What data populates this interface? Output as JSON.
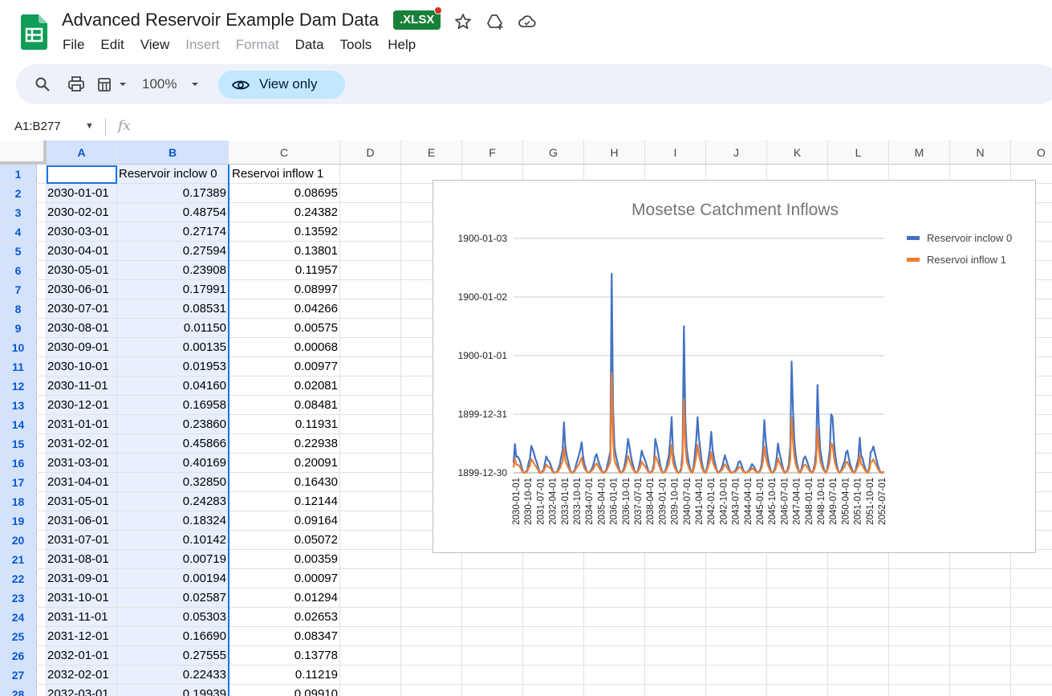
{
  "header": {
    "doc_title": "Advanced Reservoir Example Dam Data",
    "file_badge": ".XLSX",
    "menu": [
      {
        "label": "File",
        "enabled": true
      },
      {
        "label": "Edit",
        "enabled": true
      },
      {
        "label": "View",
        "enabled": true
      },
      {
        "label": "Insert",
        "enabled": false
      },
      {
        "label": "Format",
        "enabled": false
      },
      {
        "label": "Data",
        "enabled": true
      },
      {
        "label": "Tools",
        "enabled": true
      },
      {
        "label": "Help",
        "enabled": true
      }
    ]
  },
  "toolbar": {
    "zoom": "100%",
    "view_only": "View only"
  },
  "formula_bar": {
    "name_box": "A1:B277",
    "fx": "fx"
  },
  "columns": [
    "A",
    "B",
    "C",
    "D",
    "E",
    "F",
    "G",
    "H",
    "I",
    "J",
    "K",
    "L",
    "M",
    "N",
    "O"
  ],
  "rows": [
    {
      "n": "1",
      "a": "",
      "b": "Reservoir inclow 0",
      "c": "Reservoi inflow 1"
    },
    {
      "n": "2",
      "a": "2030-01-01",
      "b": "0.17389",
      "c": "0.08695"
    },
    {
      "n": "3",
      "a": "2030-02-01",
      "b": "0.48754",
      "c": "0.24382"
    },
    {
      "n": "4",
      "a": "2030-03-01",
      "b": "0.27174",
      "c": "0.13592"
    },
    {
      "n": "5",
      "a": "2030-04-01",
      "b": "0.27594",
      "c": "0.13801"
    },
    {
      "n": "6",
      "a": "2030-05-01",
      "b": "0.23908",
      "c": "0.11957"
    },
    {
      "n": "7",
      "a": "2030-06-01",
      "b": "0.17991",
      "c": "0.08997"
    },
    {
      "n": "8",
      "a": "2030-07-01",
      "b": "0.08531",
      "c": "0.04266"
    },
    {
      "n": "9",
      "a": "2030-08-01",
      "b": "0.01150",
      "c": "0.00575"
    },
    {
      "n": "10",
      "a": "2030-09-01",
      "b": "0.00135",
      "c": "0.00068"
    },
    {
      "n": "11",
      "a": "2030-10-01",
      "b": "0.01953",
      "c": "0.00977"
    },
    {
      "n": "12",
      "a": "2030-11-01",
      "b": "0.04160",
      "c": "0.02081"
    },
    {
      "n": "13",
      "a": "2030-12-01",
      "b": "0.16958",
      "c": "0.08481"
    },
    {
      "n": "14",
      "a": "2031-01-01",
      "b": "0.23860",
      "c": "0.11931"
    },
    {
      "n": "15",
      "a": "2031-02-01",
      "b": "0.45866",
      "c": "0.22938"
    },
    {
      "n": "16",
      "a": "2031-03-01",
      "b": "0.40169",
      "c": "0.20091"
    },
    {
      "n": "17",
      "a": "2031-04-01",
      "b": "0.32850",
      "c": "0.16430"
    },
    {
      "n": "18",
      "a": "2031-05-01",
      "b": "0.24283",
      "c": "0.12144"
    },
    {
      "n": "19",
      "a": "2031-06-01",
      "b": "0.18324",
      "c": "0.09164"
    },
    {
      "n": "20",
      "a": "2031-07-01",
      "b": "0.10142",
      "c": "0.05072"
    },
    {
      "n": "21",
      "a": "2031-08-01",
      "b": "0.00719",
      "c": "0.00359"
    },
    {
      "n": "22",
      "a": "2031-09-01",
      "b": "0.00194",
      "c": "0.00097"
    },
    {
      "n": "23",
      "a": "2031-10-01",
      "b": "0.02587",
      "c": "0.01294"
    },
    {
      "n": "24",
      "a": "2031-11-01",
      "b": "0.05303",
      "c": "0.02653"
    },
    {
      "n": "25",
      "a": "2031-12-01",
      "b": "0.16690",
      "c": "0.08347"
    },
    {
      "n": "26",
      "a": "2032-01-01",
      "b": "0.27555",
      "c": "0.13778"
    },
    {
      "n": "27",
      "a": "2032-02-01",
      "b": "0.22433",
      "c": "0.11219"
    },
    {
      "n": "28",
      "a": "2032-03-01",
      "b": "0.19939",
      "c": "0.09910"
    }
  ],
  "chart_data": {
    "type": "line",
    "title": "Mosetse Catchment Inflows",
    "ytick_labels": [
      "1899-12-30",
      "1899-12-31",
      "1900-01-01",
      "1900-01-02",
      "1900-01-03"
    ],
    "ylim": [
      0,
      4
    ],
    "xtick_labels": [
      "2030-01-01",
      "2030-10-01",
      "2031-07-01",
      "2032-04-01",
      "2033-01-01",
      "2033-10-01",
      "2034-07-01",
      "2035-04-01",
      "2036-01-01",
      "2036-10-01",
      "2037-07-01",
      "2038-04-01",
      "2039-01-01",
      "2039-10-01",
      "2040-07-01",
      "2041-04-01",
      "2042-01-01",
      "2042-10-01",
      "2043-07-01",
      "2044-04-01",
      "2045-01-01",
      "2045-10-01",
      "2046-07-01",
      "2047-04-01",
      "2048-01-01",
      "2048-10-01",
      "2049-07-01",
      "2050-04-01",
      "2051-01-01",
      "2051-10-01",
      "2052-07-01"
    ],
    "legend_position": "right",
    "grid": true,
    "colors": {
      "series0": "#4472c4",
      "series1": "#ed7d31"
    },
    "series": [
      {
        "name": "Reservoir inclow 0",
        "values": [
          0.17,
          0.49,
          0.27,
          0.28,
          0.24,
          0.18,
          0.09,
          0.01,
          0.0,
          0.02,
          0.04,
          0.17,
          0.24,
          0.46,
          0.4,
          0.33,
          0.24,
          0.18,
          0.1,
          0.01,
          0.0,
          0.03,
          0.05,
          0.17,
          0.28,
          0.22,
          0.2,
          0.15,
          0.08,
          0.02,
          0.0,
          0.01,
          0.02,
          0.08,
          0.15,
          0.28,
          0.38,
          0.86,
          0.45,
          0.3,
          0.2,
          0.1,
          0.02,
          0.0,
          0.02,
          0.05,
          0.15,
          0.22,
          0.3,
          0.4,
          0.52,
          0.28,
          0.15,
          0.08,
          0.01,
          0.0,
          0.02,
          0.05,
          0.1,
          0.18,
          0.28,
          0.32,
          0.22,
          0.15,
          0.08,
          0.02,
          0.0,
          0.02,
          0.05,
          0.15,
          0.25,
          0.38,
          3.4,
          1.1,
          0.45,
          0.3,
          0.2,
          0.1,
          0.02,
          0.0,
          0.03,
          0.08,
          0.2,
          0.35,
          0.58,
          0.45,
          0.3,
          0.18,
          0.1,
          0.02,
          0.0,
          0.03,
          0.1,
          0.22,
          0.38,
          0.3,
          0.24,
          0.18,
          0.1,
          0.02,
          0.0,
          0.02,
          0.05,
          0.15,
          0.58,
          0.48,
          0.35,
          0.22,
          0.1,
          0.02,
          0.0,
          0.02,
          0.08,
          0.2,
          0.3,
          0.58,
          0.95,
          0.35,
          0.2,
          0.1,
          0.02,
          0.0,
          0.02,
          0.08,
          0.35,
          2.5,
          0.95,
          0.42,
          0.25,
          0.12,
          0.03,
          0.0,
          0.1,
          0.3,
          0.55,
          0.95,
          0.6,
          0.4,
          0.2,
          0.08,
          0.02,
          0.0,
          0.1,
          0.25,
          0.4,
          0.7,
          0.4,
          0.25,
          0.15,
          0.05,
          0.0,
          0.02,
          0.05,
          0.1,
          0.2,
          0.3,
          0.22,
          0.15,
          0.08,
          0.02,
          0.0,
          0.01,
          0.02,
          0.05,
          0.1,
          0.18,
          0.2,
          0.15,
          0.08,
          0.02,
          0.0,
          0.01,
          0.02,
          0.05,
          0.1,
          0.15,
          0.12,
          0.08,
          0.03,
          0.0,
          0.02,
          0.05,
          0.15,
          0.4,
          0.9,
          0.55,
          0.35,
          0.2,
          0.1,
          0.02,
          0.0,
          0.03,
          0.1,
          0.25,
          0.5,
          0.35,
          0.25,
          0.15,
          0.05,
          0.0,
          0.02,
          0.05,
          0.15,
          0.45,
          1.9,
          1.1,
          0.55,
          0.3,
          0.15,
          0.05,
          0.0,
          0.05,
          0.15,
          0.25,
          0.28,
          0.22,
          0.15,
          0.08,
          0.02,
          0.0,
          0.05,
          0.15,
          0.4,
          1.5,
          0.8,
          0.4,
          0.25,
          0.12,
          0.05,
          0.0,
          0.05,
          0.2,
          0.4,
          1.0,
          0.95,
          0.55,
          0.3,
          0.15,
          0.05,
          0.0,
          0.02,
          0.08,
          0.15,
          0.2,
          0.35,
          0.38,
          0.25,
          0.15,
          0.08,
          0.02,
          0.0,
          0.05,
          0.15,
          0.25,
          0.6,
          0.3,
          0.25,
          0.15,
          0.08,
          0.02,
          0.0,
          0.1,
          0.35,
          0.38,
          0.45,
          0.35,
          0.25,
          0.15,
          0.08,
          0.02,
          0.0,
          0.01,
          0.02
        ]
      },
      {
        "name": "Reservoi inflow 1",
        "values": [
          0.09,
          0.24,
          0.14,
          0.14,
          0.12,
          0.09,
          0.04,
          0.01,
          0.0,
          0.01,
          0.02,
          0.08,
          0.12,
          0.23,
          0.2,
          0.16,
          0.12,
          0.09,
          0.05,
          0.0,
          0.0,
          0.01,
          0.03,
          0.08,
          0.14,
          0.11,
          0.1,
          0.08,
          0.04,
          0.01,
          0.0,
          0.01,
          0.01,
          0.04,
          0.08,
          0.14,
          0.19,
          0.43,
          0.22,
          0.15,
          0.1,
          0.05,
          0.01,
          0.0,
          0.01,
          0.03,
          0.08,
          0.11,
          0.15,
          0.2,
          0.26,
          0.14,
          0.08,
          0.04,
          0.01,
          0.0,
          0.01,
          0.03,
          0.05,
          0.09,
          0.14,
          0.16,
          0.11,
          0.08,
          0.04,
          0.01,
          0.0,
          0.01,
          0.03,
          0.08,
          0.13,
          0.19,
          1.7,
          0.55,
          0.22,
          0.15,
          0.1,
          0.05,
          0.01,
          0.0,
          0.02,
          0.04,
          0.1,
          0.18,
          0.29,
          0.22,
          0.15,
          0.09,
          0.05,
          0.01,
          0.0,
          0.02,
          0.05,
          0.11,
          0.19,
          0.15,
          0.12,
          0.09,
          0.05,
          0.01,
          0.0,
          0.01,
          0.03,
          0.08,
          0.29,
          0.24,
          0.18,
          0.11,
          0.05,
          0.01,
          0.0,
          0.01,
          0.04,
          0.1,
          0.15,
          0.29,
          0.48,
          0.18,
          0.1,
          0.05,
          0.01,
          0.0,
          0.01,
          0.04,
          0.18,
          1.25,
          0.48,
          0.21,
          0.13,
          0.06,
          0.02,
          0.0,
          0.05,
          0.15,
          0.28,
          0.48,
          0.3,
          0.2,
          0.1,
          0.04,
          0.01,
          0.0,
          0.05,
          0.13,
          0.2,
          0.35,
          0.2,
          0.13,
          0.08,
          0.03,
          0.0,
          0.01,
          0.03,
          0.05,
          0.1,
          0.15,
          0.11,
          0.08,
          0.04,
          0.01,
          0.0,
          0.01,
          0.01,
          0.03,
          0.05,
          0.09,
          0.1,
          0.08,
          0.04,
          0.01,
          0.0,
          0.01,
          0.01,
          0.03,
          0.05,
          0.08,
          0.06,
          0.04,
          0.02,
          0.0,
          0.01,
          0.03,
          0.08,
          0.2,
          0.45,
          0.28,
          0.18,
          0.1,
          0.05,
          0.01,
          0.0,
          0.02,
          0.05,
          0.13,
          0.25,
          0.18,
          0.13,
          0.08,
          0.03,
          0.0,
          0.01,
          0.03,
          0.08,
          0.23,
          0.95,
          0.55,
          0.28,
          0.15,
          0.08,
          0.03,
          0.0,
          0.03,
          0.08,
          0.13,
          0.14,
          0.11,
          0.08,
          0.04,
          0.01,
          0.0,
          0.03,
          0.08,
          0.2,
          0.75,
          0.4,
          0.2,
          0.13,
          0.06,
          0.03,
          0.0,
          0.03,
          0.1,
          0.2,
          0.5,
          0.48,
          0.28,
          0.15,
          0.08,
          0.03,
          0.0,
          0.01,
          0.04,
          0.08,
          0.1,
          0.18,
          0.19,
          0.13,
          0.08,
          0.04,
          0.01,
          0.0,
          0.03,
          0.08,
          0.13,
          0.3,
          0.15,
          0.13,
          0.08,
          0.04,
          0.01,
          0.0,
          0.05,
          0.18,
          0.19,
          0.23,
          0.18,
          0.13,
          0.08,
          0.04,
          0.01,
          0.0,
          0.01,
          0.01
        ]
      }
    ]
  }
}
